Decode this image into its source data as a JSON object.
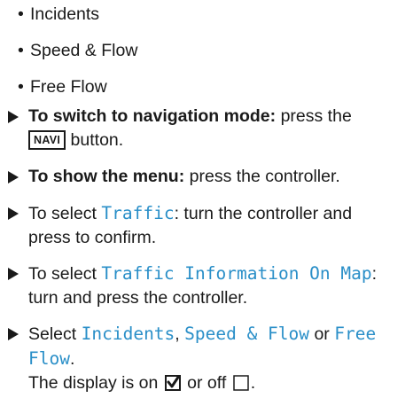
{
  "bullets": [
    "Incidents",
    "Speed & Flow",
    "Free Flow"
  ],
  "steps": {
    "s1": {
      "bold": "To switch to navigation mode:",
      "text_a": " press the",
      "key": "NAVI",
      "text_b": " button."
    },
    "s2": {
      "bold": "To show the menu:",
      "text": " press the controller."
    },
    "s3": {
      "pre": "To select ",
      "disp": "Traffic",
      "post": ": turn the controller and",
      "line2": "press to confirm."
    },
    "s4": {
      "pre": "To select ",
      "disp": "Traffic Information On Map",
      "post": ":",
      "line2": "turn and press the controller."
    },
    "s5": {
      "pre": "Select ",
      "disp1": "Incidents",
      "sep1": ", ",
      "disp2": "Speed & Flow",
      "sep2": " or ",
      "disp3a": "Free",
      "disp3b": "Flow",
      "post": "."
    }
  },
  "note": {
    "a": "The display is on",
    "b": "or off",
    "c": "."
  },
  "icons": {
    "step_marker": "triangle-right-icon",
    "on": "checkbox-checked-icon",
    "off": "checkbox-empty-icon"
  },
  "colors": {
    "display_text": "#2a8fc8"
  }
}
